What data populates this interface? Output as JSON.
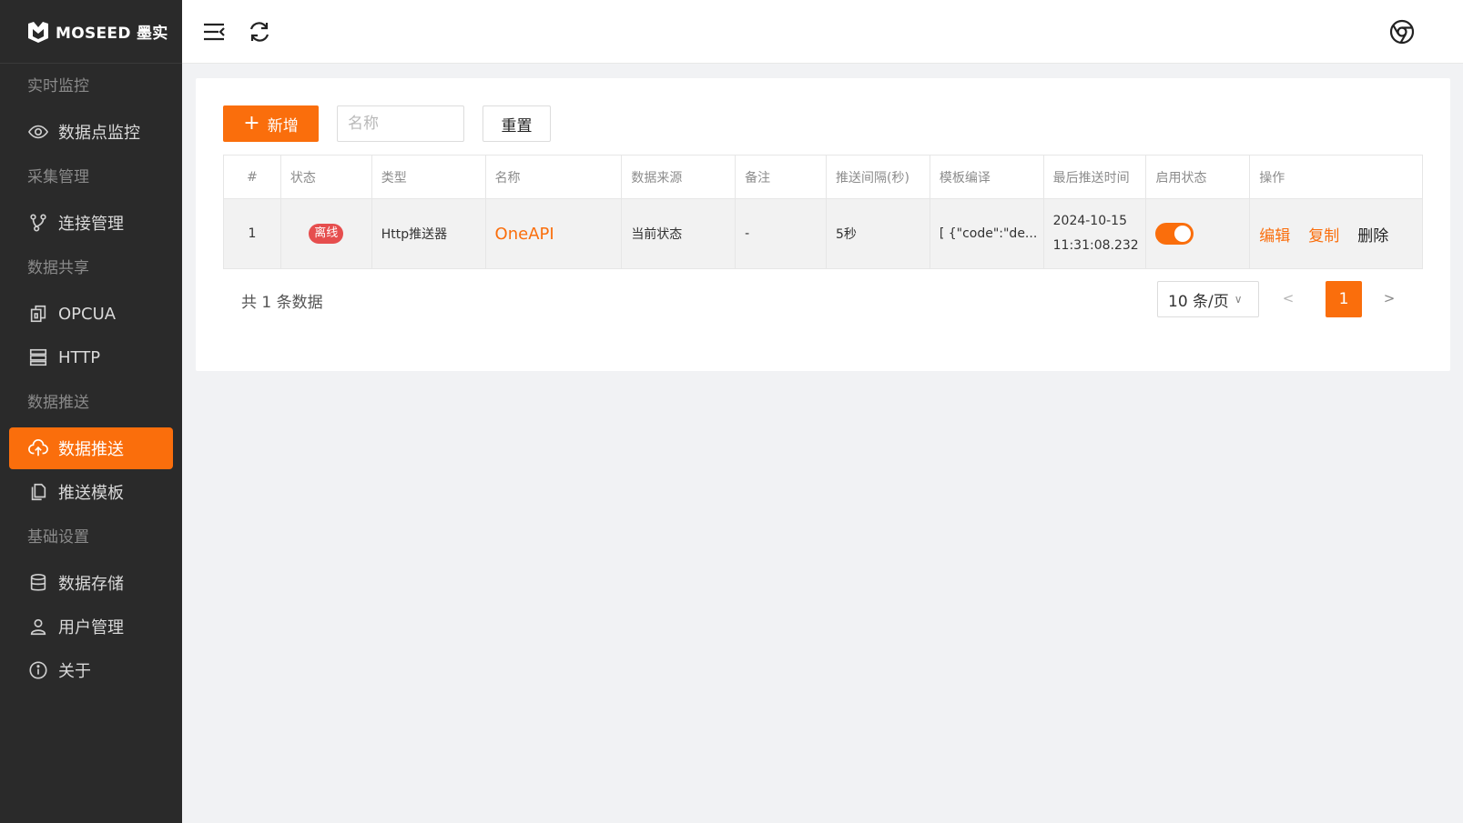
{
  "brand": {
    "name": "MOSEED 墨实"
  },
  "sidebar": {
    "groups": [
      {
        "title": "实时监控",
        "items": [
          {
            "label": "数据点监控",
            "icon": "eye-icon"
          }
        ]
      },
      {
        "title": "采集管理",
        "items": [
          {
            "label": "连接管理",
            "icon": "branch-icon"
          }
        ]
      },
      {
        "title": "数据共享",
        "items": [
          {
            "label": "OPCUA",
            "icon": "opcua-icon"
          },
          {
            "label": "HTTP",
            "icon": "server-icon"
          }
        ]
      },
      {
        "title": "数据推送",
        "items": [
          {
            "label": "数据推送",
            "icon": "cloud-upload-icon",
            "active": true
          },
          {
            "label": "推送模板",
            "icon": "copy-icon"
          }
        ]
      },
      {
        "title": "基础设置",
        "items": [
          {
            "label": "数据存储",
            "icon": "database-icon"
          },
          {
            "label": "用户管理",
            "icon": "user-icon"
          },
          {
            "label": "关于",
            "icon": "info-icon"
          }
        ]
      }
    ]
  },
  "toolbar": {
    "add_label": "新增",
    "name_placeholder": "名称",
    "reset_label": "重置"
  },
  "table": {
    "columns": [
      "#",
      "状态",
      "类型",
      "名称",
      "数据来源",
      "备注",
      "推送间隔(秒)",
      "模板编译",
      "最后推送时间",
      "启用状态",
      "操作"
    ],
    "rows": [
      {
        "index": "1",
        "status": "离线",
        "type": "Http推送器",
        "name": "OneAPI",
        "source": "当前状态",
        "remark": "-",
        "interval": "5秒",
        "template": "[ {\"code\":\"de...",
        "last_push_date": "2024-10-15",
        "last_push_time": "11:31:08.232",
        "enabled": true,
        "actions": {
          "edit": "编辑",
          "copy": "复制",
          "delete": "删除"
        }
      }
    ]
  },
  "footer": {
    "total_text": "共 1 条数据",
    "page_size": "10 条/页",
    "current_page": "1"
  },
  "colors": {
    "accent": "#fa6e0c",
    "sidebar_bg": "#2a2a2a",
    "offline_badge": "#e64e4e"
  }
}
